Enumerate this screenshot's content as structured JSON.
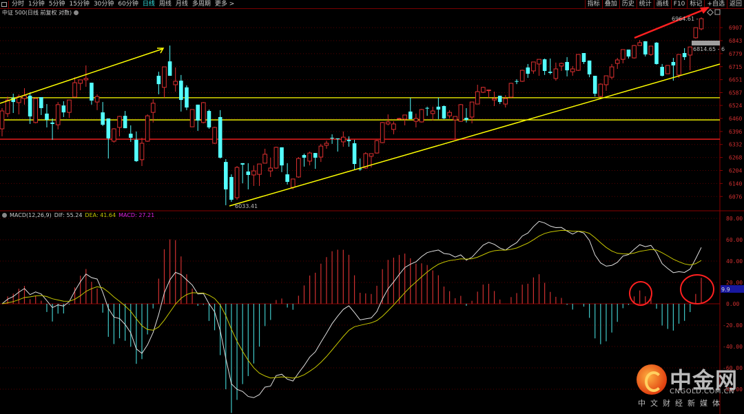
{
  "toolbar": {
    "periods": [
      "分时",
      "1分钟",
      "5分钟",
      "15分钟",
      "30分钟",
      "60分钟",
      "日线",
      "周线",
      "月线",
      "多周期",
      "更多 >"
    ],
    "active_period": "日线",
    "buttons": [
      "指标",
      "叠加",
      "历史",
      "统计",
      "画线",
      "F10",
      "标记",
      "+自选",
      "返回"
    ]
  },
  "title": "中证 500(日线 前复权 对数)",
  "macd": {
    "name": "MACD(12,26,9)",
    "dif_label": "DIF: 55.24",
    "dea_label": "DEA: 41.64",
    "macd_label": "MACD: 27.21",
    "tag_value": "9.9"
  },
  "annotations": {
    "low_label": "6033.41",
    "high_label": "6964.61 -",
    "price_tag": "6814.65 - 6"
  },
  "watermark": {
    "name": "中金网",
    "domain": "CNGOLD.COM.CN",
    "slogan": "中文财经新媒体"
  },
  "colors": {
    "up": "#e03030",
    "down": "#54ffff",
    "dif": "#e0e0e0",
    "dea": "#c8c800",
    "macd_text": "#e020e0",
    "axis": "#d03030",
    "support": "#ffff00",
    "resistance": "#ff2020"
  },
  "chart_data": {
    "type": "candlestick",
    "title": "中证 500(日线 前复权 对数)",
    "price_axis": {
      "ticks": [
        6907,
        6843,
        6779,
        6715,
        6651,
        6587,
        6524,
        6460,
        6396,
        6332,
        6268,
        6204,
        6140,
        6076
      ]
    },
    "macd_axis": {
      "ticks": [
        "80.00",
        "60.00",
        "40.00",
        "20.00",
        "0.00",
        "-20.00",
        "-40.00",
        "-60.00",
        "-80.00"
      ],
      "range": [
        -80,
        80
      ]
    },
    "horizontal_lines": [
      {
        "price": 6562,
        "color": "yellow"
      },
      {
        "price": 6453,
        "color": "yellow"
      },
      {
        "price": 6358,
        "color": "red"
      }
    ],
    "candles_ohlc_note": "each entry [open, close, high, low]",
    "candles": [
      [
        6409,
        6497,
        6511,
        6372
      ],
      [
        6484,
        6551,
        6568,
        6467
      ],
      [
        6562,
        6541,
        6582,
        6487
      ],
      [
        6538,
        6568,
        6579,
        6480
      ],
      [
        6558,
        6572,
        6609,
        6528
      ],
      [
        6572,
        6470,
        6589,
        6433
      ],
      [
        6440,
        6558,
        6562,
        6436
      ],
      [
        6565,
        6511,
        6565,
        6477
      ],
      [
        6484,
        6453,
        6531,
        6416
      ],
      [
        6440,
        6433,
        6460,
        6355
      ],
      [
        6429,
        6528,
        6541,
        6406
      ],
      [
        6524,
        6490,
        6545,
        6467
      ],
      [
        6490,
        6551,
        6551,
        6463
      ],
      [
        6565,
        6636,
        6663,
        6565
      ],
      [
        6633,
        6650,
        6650,
        6599
      ],
      [
        6650,
        6657,
        6721,
        6616
      ],
      [
        6636,
        6548,
        6636,
        6528
      ],
      [
        6541,
        6568,
        6579,
        6501
      ],
      [
        6490,
        6429,
        6541,
        6423
      ],
      [
        6460,
        6362,
        6460,
        6263
      ],
      [
        6348,
        6409,
        6412,
        6341
      ],
      [
        6416,
        6470,
        6473,
        6372
      ],
      [
        6473,
        6412,
        6497,
        6412
      ],
      [
        6385,
        6365,
        6426,
        6345
      ],
      [
        6355,
        6250,
        6396,
        6246
      ],
      [
        6257,
        6338,
        6365,
        6226
      ],
      [
        6348,
        6473,
        6480,
        6345
      ],
      [
        6490,
        6535,
        6555,
        6440
      ],
      [
        6670,
        6629,
        6690,
        6579
      ],
      [
        6613,
        6714,
        6714,
        6562
      ],
      [
        6741,
        6670,
        6819,
        6670
      ],
      [
        6626,
        6643,
        6711,
        6592
      ],
      [
        6646,
        6551,
        6674,
        6494
      ],
      [
        6613,
        6514,
        6623,
        6501
      ],
      [
        6419,
        6504,
        6504,
        6419
      ],
      [
        6528,
        6450,
        6528,
        6399
      ],
      [
        6440,
        6538,
        6541,
        6436
      ],
      [
        6497,
        6416,
        6504,
        6409
      ],
      [
        6338,
        6416,
        6419,
        6335
      ],
      [
        6467,
        6267,
        6501,
        6263
      ],
      [
        6246,
        6111,
        6260,
        6033
      ],
      [
        6172,
        6060,
        6185,
        6050
      ],
      [
        6070,
        6219,
        6226,
        6060
      ],
      [
        6240,
        6233,
        6240,
        6141
      ],
      [
        6199,
        6182,
        6240,
        6111
      ],
      [
        6182,
        6202,
        6229,
        6128
      ],
      [
        6185,
        6236,
        6236,
        6128
      ],
      [
        6240,
        6284,
        6311,
        6240
      ],
      [
        6202,
        6216,
        6267,
        6172
      ],
      [
        6216,
        6318,
        6321,
        6212
      ],
      [
        6318,
        6229,
        6318,
        6196
      ],
      [
        6185,
        6148,
        6240,
        6135
      ],
      [
        6121,
        6162,
        6162,
        6111
      ],
      [
        6172,
        6263,
        6270,
        6168
      ],
      [
        6280,
        6267,
        6287,
        6223
      ],
      [
        6250,
        6290,
        6297,
        6229
      ],
      [
        6290,
        6267,
        6290,
        6212
      ],
      [
        6270,
        6324,
        6335,
        6246
      ],
      [
        6328,
        6338,
        6351,
        6311
      ],
      [
        6365,
        6362,
        6382,
        6335
      ],
      [
        6362,
        6360,
        6362,
        6297
      ],
      [
        6345,
        6368,
        6396,
        6321
      ],
      [
        6355,
        6348,
        6372,
        6321
      ],
      [
        6338,
        6236,
        6355,
        6209
      ],
      [
        6213,
        6210,
        6263,
        6202
      ],
      [
        6216,
        6287,
        6294,
        6212
      ],
      [
        6274,
        6287,
        6287,
        6219
      ],
      [
        6290,
        6351,
        6355,
        6287
      ],
      [
        6341,
        6440,
        6443,
        6338
      ],
      [
        6433,
        6443,
        6480,
        6426
      ],
      [
        6406,
        6433,
        6446,
        6382
      ],
      [
        6457,
        6460,
        6463,
        6453
      ],
      [
        6457,
        6477,
        6477,
        6426
      ],
      [
        6494,
        6457,
        6562,
        6457
      ],
      [
        6446,
        6460,
        6484,
        6416
      ],
      [
        6443,
        6504,
        6507,
        6440
      ],
      [
        6512,
        6510,
        6518,
        6473
      ],
      [
        6484,
        6497,
        6518,
        6450
      ],
      [
        6518,
        6504,
        6562,
        6457
      ],
      [
        6521,
        6460,
        6524,
        6457
      ],
      [
        6473,
        6490,
        6501,
        6460
      ],
      [
        6453,
        6470,
        6470,
        6358
      ],
      [
        6446,
        6528,
        6531,
        6443
      ],
      [
        6463,
        6453,
        6511,
        6440
      ],
      [
        6467,
        6541,
        6541,
        6436
      ],
      [
        6531,
        6592,
        6626,
        6531
      ],
      [
        6589,
        6613,
        6616,
        6585
      ],
      [
        6598,
        6600,
        6602,
        6562
      ],
      [
        6551,
        6558,
        6592,
        6521
      ],
      [
        6572,
        6541,
        6572,
        6531
      ],
      [
        6531,
        6558,
        6575,
        6514
      ],
      [
        6565,
        6633,
        6636,
        6562
      ],
      [
        6644,
        6642,
        6653,
        6629
      ],
      [
        6643,
        6697,
        6700,
        6640
      ],
      [
        6711,
        6680,
        6728,
        6660
      ],
      [
        6694,
        6738,
        6738,
        6680
      ],
      [
        6728,
        6751,
        6751,
        6670
      ],
      [
        6751,
        6694,
        6755,
        6674
      ],
      [
        6690,
        6684,
        6755,
        6677
      ],
      [
        6657,
        6704,
        6735,
        6646
      ],
      [
        6718,
        6731,
        6735,
        6694
      ],
      [
        6738,
        6697,
        6762,
        6667
      ],
      [
        6690,
        6704,
        6718,
        6670
      ],
      [
        6697,
        6775,
        6775,
        6694
      ],
      [
        6782,
        6738,
        6782,
        6728
      ],
      [
        6745,
        6677,
        6745,
        6663
      ],
      [
        6670,
        6582,
        6670,
        6568
      ],
      [
        6568,
        6629,
        6633,
        6565
      ],
      [
        6626,
        6670,
        6670,
        6596
      ],
      [
        6663,
        6714,
        6728,
        6653
      ],
      [
        6731,
        6748,
        6758,
        6704
      ],
      [
        6751,
        6799,
        6799,
        6731
      ],
      [
        6799,
        6765,
        6799,
        6755
      ],
      [
        6758,
        6819,
        6822,
        6755
      ],
      [
        6819,
        6833,
        6846,
        6819
      ],
      [
        6840,
        6775,
        6840,
        6765
      ],
      [
        6775,
        6816,
        6816,
        6768
      ],
      [
        6833,
        6728,
        6836,
        6725
      ],
      [
        6714,
        6670,
        6728,
        6667
      ],
      [
        6680,
        6721,
        6721,
        6680
      ],
      [
        6738,
        6721,
        6758,
        6646
      ],
      [
        6674,
        6775,
        6775,
        6660
      ],
      [
        6782,
        6762,
        6806,
        6748
      ],
      [
        6772,
        6812,
        6812,
        6697
      ],
      [
        6857,
        6907,
        6907,
        6853
      ],
      [
        6901,
        6951,
        6958,
        6894
      ]
    ]
  }
}
